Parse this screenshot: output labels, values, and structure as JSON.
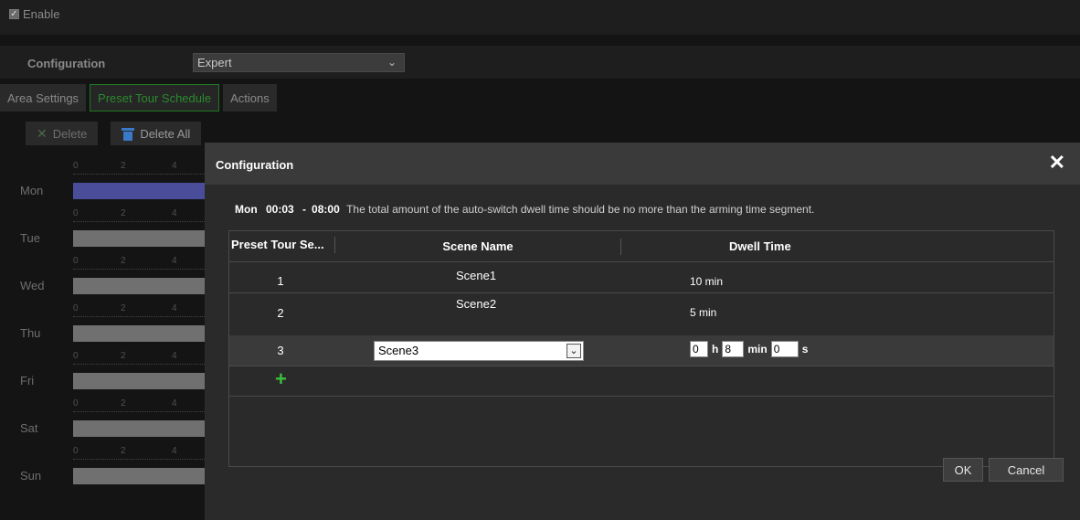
{
  "page": {
    "enable_label": "Enable",
    "configuration_label": "Configuration",
    "configuration_value": "Expert",
    "tabs": [
      {
        "label": "Area Settings"
      },
      {
        "label": "Preset Tour Schedule"
      },
      {
        "label": "Actions"
      }
    ],
    "toolbar": {
      "delete_label": "Delete",
      "delete_all_label": "Delete All"
    },
    "tick_labels": [
      "0",
      "2",
      "4"
    ],
    "days": [
      "Mon",
      "Tue",
      "Wed",
      "Thu",
      "Fri",
      "Sat",
      "Sun"
    ]
  },
  "dialog": {
    "title": "Configuration",
    "close_glyph": "✕",
    "info": {
      "day": "Mon",
      "start": "00:03",
      "dash": "-",
      "end": "08:00",
      "message": "The total amount of the auto-switch dwell time should be no more than the arming time segment."
    },
    "columns": {
      "seq": "Preset Tour Se...",
      "scene": "Scene Name",
      "dwell": "Dwell Time"
    },
    "rows": [
      {
        "index": "1",
        "scene": "Scene1",
        "dwell": "10 min"
      },
      {
        "index": "2",
        "scene": "Scene2",
        "dwell": "5 min"
      }
    ],
    "edit_row": {
      "index": "3",
      "scene": "Scene3",
      "hours": "0",
      "h_unit": "h",
      "minutes": "8",
      "min_unit": "min",
      "seconds": "0",
      "s_unit": "s"
    },
    "add_glyph": "+",
    "ok_label": "OK",
    "cancel_label": "Cancel"
  }
}
